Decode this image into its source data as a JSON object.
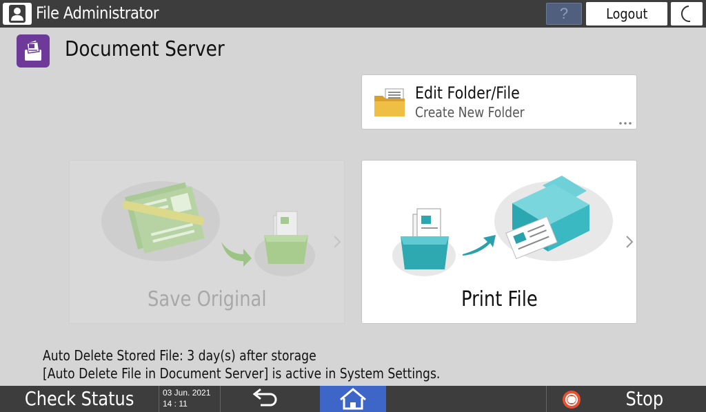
{
  "topbar": {
    "user_title": "File Administrator",
    "help_label": "?",
    "logout_label": "Logout"
  },
  "header": {
    "title": "Document Server"
  },
  "edit_card": {
    "title": "Edit Folder/File",
    "subtitle": "Create New Folder"
  },
  "tiles": {
    "save_original": {
      "label": "Save Original",
      "enabled": false
    },
    "print_file": {
      "label": "Print File",
      "enabled": true
    }
  },
  "notice": {
    "line1": "Auto Delete Stored File: 3 day(s) after storage",
    "line2": "[Auto Delete File in Document Server] is active in System Settings."
  },
  "bottombar": {
    "check_status": "Check Status",
    "date": "03 Jun. 2021",
    "time": "14 : 11",
    "stop_label": "Stop"
  },
  "colors": {
    "bar": "#3d3d3d",
    "home_active": "#3e66c8",
    "app_icon": "#6d3a99",
    "teal": "#3bb9c2",
    "green": "#7fb85b",
    "folder": "#e9b53b",
    "stop_red": "#e8502f"
  },
  "icons": {
    "user": "user-icon",
    "moon": "moon-icon",
    "app": "document-server-icon",
    "folder": "folder-icon",
    "more": "more-dots-icon",
    "back": "back-arrow-icon",
    "home": "home-icon",
    "stop": "stop-icon"
  }
}
